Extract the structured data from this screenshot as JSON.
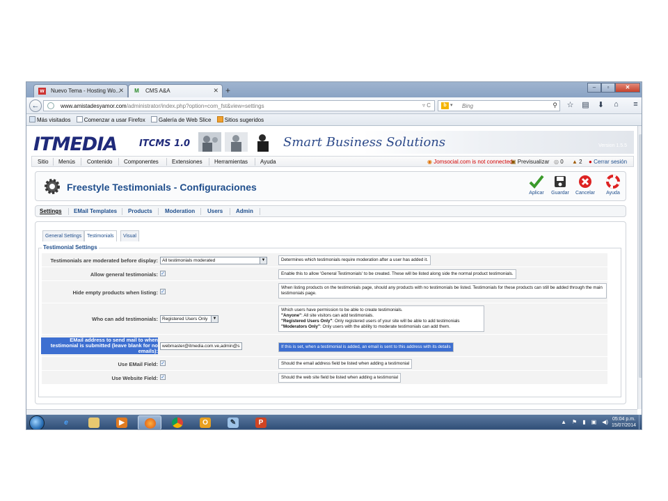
{
  "browser": {
    "tabs": [
      {
        "label": "Nuevo Tema - Hosting Wo...",
        "active": false
      },
      {
        "label": "CMS A&A",
        "active": true
      }
    ],
    "new_tab": "+",
    "url_domain": "www.amistadesyamor.com",
    "url_path": "/administrator/index.php?option=com_fst&view=settings",
    "search_placeholder": "Bing",
    "bookmarks": [
      "Más visitados",
      "Comenzar a usar Firefox",
      "Galería de Web Slice",
      "Sitios sugeridos"
    ]
  },
  "banner": {
    "logo": "ITMEDIA",
    "product": "ITCMS 1.0",
    "slogan": "Smart Business Solutions",
    "version": "Version 1.5.5"
  },
  "menu": {
    "items": [
      "Sitio",
      "Menús",
      "Contenido",
      "Componentes",
      "Extensiones",
      "Herramientas",
      "Ayuda"
    ],
    "jomsocial_status": "Jomsocial.com is not connected",
    "preview": "Previsualizar",
    "count_messages": "0",
    "count_users": "2",
    "logout": "Cerrar sesión"
  },
  "header": {
    "title": "Freestyle Testimonials - Configuraciones",
    "toolbar": [
      {
        "label": "Aplicar",
        "icon": "check-icon"
      },
      {
        "label": "Guardar",
        "icon": "save-icon"
      },
      {
        "label": "Cancelar",
        "icon": "cancel-icon"
      },
      {
        "label": "Ayuda",
        "icon": "help-icon"
      }
    ]
  },
  "subtabs": [
    "Settings",
    "EMail Templates",
    "Products",
    "Moderation",
    "Users",
    "Admin"
  ],
  "inner_tabs": [
    "General Settings",
    "Testimonials",
    "Visual"
  ],
  "fieldset": {
    "legend": "Testimonial Settings",
    "rows": [
      {
        "label": "Testimonials are moderated before display:",
        "select_value": "All testimonials moderated",
        "description": "Determines which testimonials require moderation after a user has added it."
      },
      {
        "label": "Allow general testimonials:",
        "checked": "✓",
        "description": "Enable this to allow 'General Testimonials' to be created. These will be listed along side the normal product testimonials."
      },
      {
        "label": "Hide empty products when listing:",
        "checked": "✓",
        "description": "When listing products on the testimonials page, should any products with no testimonials be listed. Testimonials for these products can still be added through the main testimonials page."
      },
      {
        "label": "Who can add testimonials:",
        "select_value": "Registered Users Only",
        "description_lines": [
          {
            "bold": "",
            "text": "Which users have permission to be able to create testimonials."
          },
          {
            "bold": "\"Anyone\"",
            "text": ": All site visitors can add testimonials."
          },
          {
            "bold": "\"Registered Users Only\"",
            "text": ": Only registered users of your site will be able to add testimonials"
          },
          {
            "bold": "\"Moderators Only\"",
            "text": ": Only users with the ability to moderate testimonials can add them."
          }
        ]
      },
      {
        "label": "EMail address to send mail to when testimonial is submitted (leave blank for no emails):",
        "input_value": "webmaster@itmedia.com.ve,admin@s",
        "description": "If this is set, when a testimonial is added, an email is sent to this address with its details"
      },
      {
        "label": "Use EMail Field:",
        "checked": "✓",
        "description": "Should the email address field be listed when adding a testimonial"
      },
      {
        "label": "Use Website Field:",
        "checked": "✓",
        "description": "Should the web site field be listed when adding a testimonial"
      }
    ]
  },
  "taskbar": {
    "time": "05:04 p.m.",
    "date": "15/07/2014",
    "apps": [
      "e",
      "📁",
      "▶",
      "🦊",
      "◉",
      "O",
      "✎",
      "P"
    ]
  }
}
